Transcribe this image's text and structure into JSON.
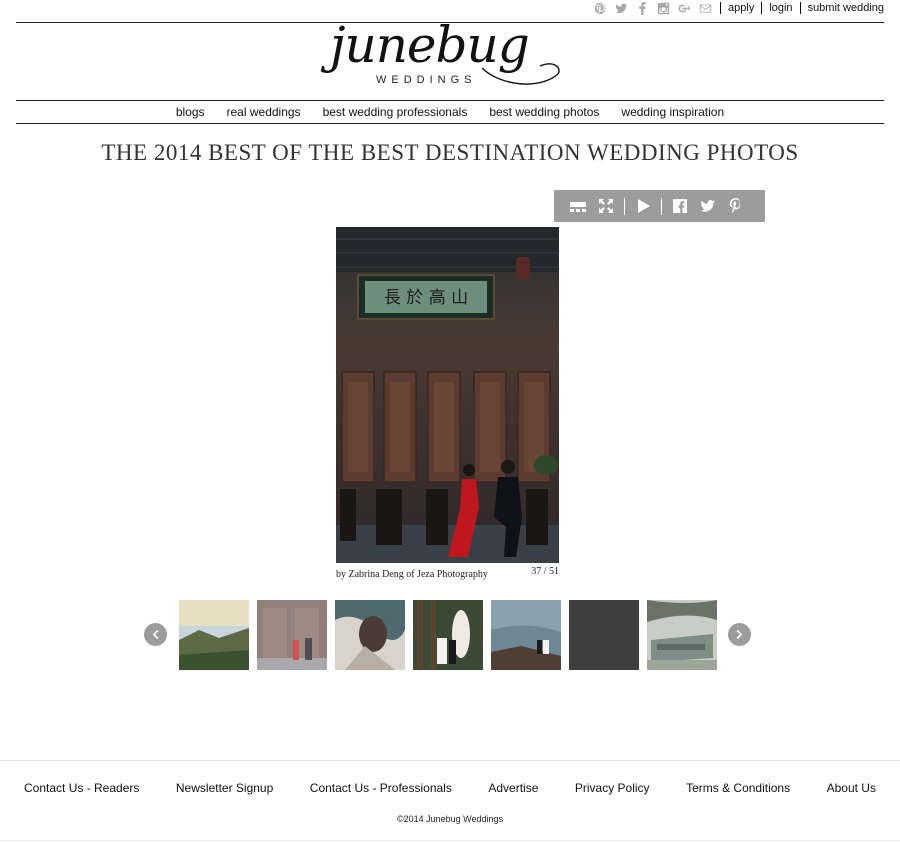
{
  "top_bar": {
    "social_icons": [
      "pinterest-icon",
      "twitter-icon",
      "facebook-icon",
      "instagram-icon",
      "google-plus-icon",
      "email-icon"
    ],
    "links": [
      "apply",
      "login",
      "submit wedding"
    ]
  },
  "logo": {
    "main": "junebug",
    "sub": "WEDDINGS"
  },
  "nav": {
    "items": [
      "blogs",
      "real weddings",
      "best wedding professionals",
      "best wedding photos",
      "wedding inspiration"
    ]
  },
  "page": {
    "title": "THE 2014 BEST OF THE BEST DESTINATION WEDDING PHOTOS"
  },
  "gallery": {
    "toolbar_icons": [
      "thumbnails-icon",
      "fullscreen-icon",
      "play-icon",
      "facebook-icon",
      "twitter-icon",
      "pinterest-icon"
    ],
    "photo": {
      "sign_text": "長 於 高 山",
      "caption": "by Zabrina Deng of Jeza Photography",
      "counter": "37 / 51"
    },
    "thumbnail_count": 7
  },
  "footer": {
    "links": [
      "Contact Us - Readers",
      "Newsletter Signup",
      "Contact Us - Professionals",
      "Advertise",
      "Privacy Policy",
      "Terms & Conditions",
      "About Us"
    ],
    "copyright": "©2014 Junebug Weddings"
  },
  "colors": {
    "toolbar_grey": "#9c9c9c",
    "text": "#111111",
    "dress_red": "#c0161d"
  }
}
